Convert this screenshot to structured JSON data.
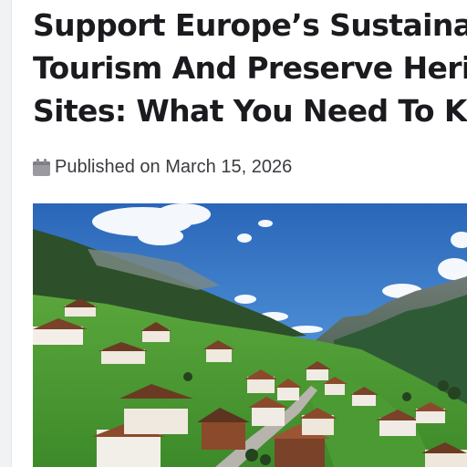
{
  "article": {
    "title_lines": [
      "Support Europe’s Sustainable",
      "Tourism And Preserve Heritage",
      "Sites: What You Need To Know"
    ],
    "published_prefix": "Published on",
    "published_date": "March 15, 2026",
    "meta_icon": "calendar-icon",
    "hero_image": {
      "subject": "alpine-village-valley-photo"
    }
  },
  "colors": {
    "title": "#1b1b1f",
    "meta_text": "#3b3b40",
    "icon": "#9a9aa0",
    "sky": "#2f6fbf",
    "meadow": "#4f9a36"
  }
}
